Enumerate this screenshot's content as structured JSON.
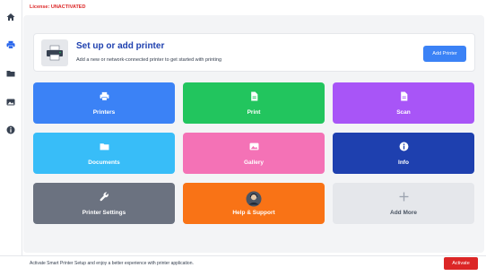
{
  "header": {
    "license_text": "License: UNACTIVATED"
  },
  "sidebar": {
    "items": [
      {
        "icon": "home-icon"
      },
      {
        "icon": "printer-icon"
      },
      {
        "icon": "folder-icon"
      },
      {
        "icon": "image-icon"
      },
      {
        "icon": "info-icon"
      }
    ]
  },
  "setup": {
    "title": "Set up or add printer",
    "description": "Add a new or network-connected printer to get started with printing",
    "button_label": "Add Printer"
  },
  "tiles": [
    {
      "label": "Printers",
      "icon": "printer-icon",
      "color": "#3b82f6"
    },
    {
      "label": "Print",
      "icon": "document-icon",
      "color": "#22c55e"
    },
    {
      "label": "Scan",
      "icon": "document-icon",
      "color": "#a855f7"
    },
    {
      "label": "Documents",
      "icon": "folder-icon",
      "color": "#38bdf8"
    },
    {
      "label": "Gallery",
      "icon": "image-icon",
      "color": "#f472b6"
    },
    {
      "label": "Info",
      "icon": "info-icon",
      "color": "#1e40af"
    },
    {
      "label": "Printer Settings",
      "icon": "wrench-icon",
      "color": "#6b7280"
    },
    {
      "label": "Help & Support",
      "icon": "support-avatar-icon",
      "color": "#f97316"
    },
    {
      "label": "Add More",
      "icon": "plus-icon",
      "color": "#e5e7eb"
    }
  ],
  "footer": {
    "text": "Activate Smart Printer Setup and enjoy a better experience with printer application.",
    "button_label": "Activate"
  }
}
